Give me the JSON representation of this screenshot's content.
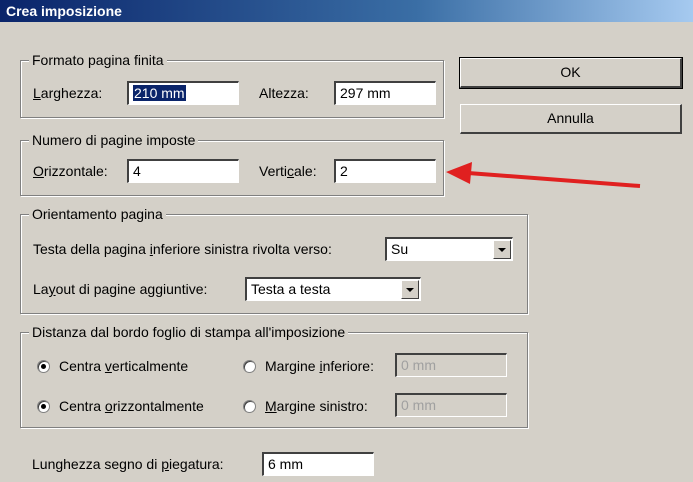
{
  "window": {
    "title": "Crea imposizione"
  },
  "buttons": {
    "ok": "OK",
    "cancel": "Annulla"
  },
  "formato": {
    "legend": "Formato pagina finita",
    "larghezza_label": "Larghezza:",
    "larghezza_value": "210 mm",
    "altezza_label": "Altezza:",
    "altezza_value": "297 mm"
  },
  "numero": {
    "legend": "Numero di pagine imposte",
    "orizzontale_label": "Orizzontale:",
    "orizzontale_value": "4",
    "verticale_label": "Verticale:",
    "verticale_value": "2"
  },
  "orientamento": {
    "legend": "Orientamento pagina",
    "testa_label": "Testa della pagina inferiore sinistra rivolta verso:",
    "testa_value": "Su",
    "layout_label": "Layout di pagine aggiuntive:",
    "layout_value": "Testa a testa"
  },
  "distanza": {
    "legend": "Distanza dal bordo foglio di stampa all'imposizione",
    "centra_vert": "Centra verticalmente",
    "centra_orizz": "Centra orizzontalmente",
    "margine_inf_label": "Margine inferiore:",
    "margine_inf_value": "0 mm",
    "margine_sin_label": "Margine sinistro:",
    "margine_sin_value": "0 mm"
  },
  "piegatura": {
    "label": "Lunghezza segno di piegatura:",
    "value": "6 mm"
  },
  "annotation": {
    "arrow_color": "#e02020"
  }
}
